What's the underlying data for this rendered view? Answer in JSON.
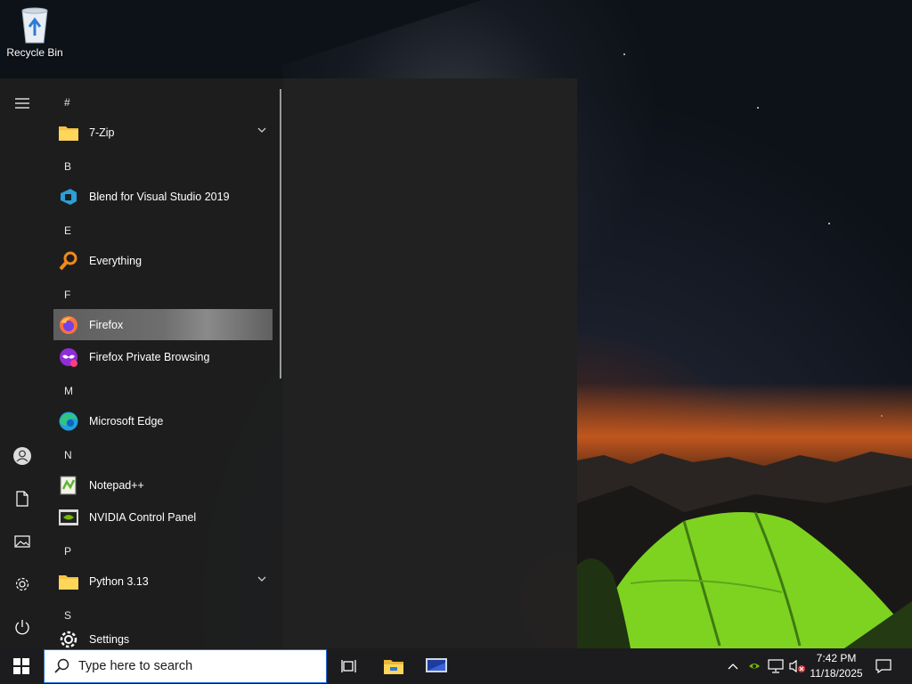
{
  "desktop": {
    "icons": [
      {
        "label": "Recycle Bin",
        "icon": "recycle-bin-icon"
      }
    ]
  },
  "start_menu": {
    "rail": [
      {
        "icon": "hamburger-menu-icon"
      },
      {
        "icon": "user-account-icon"
      },
      {
        "icon": "documents-icon"
      },
      {
        "icon": "pictures-icon"
      },
      {
        "icon": "settings-gear-icon"
      },
      {
        "icon": "power-icon"
      }
    ],
    "headers": {
      "hash": "#",
      "b": "B",
      "e": "E",
      "f": "F",
      "m": "M",
      "n": "N",
      "p": "P",
      "s": "S"
    },
    "apps": {
      "sevenzip": {
        "label": "7-Zip",
        "icon": "folder-icon",
        "expandable": true
      },
      "blend": {
        "label": "Blend for Visual Studio 2019",
        "icon": "blend-icon"
      },
      "everything": {
        "label": "Everything",
        "icon": "magnifier-search-icon"
      },
      "firefox": {
        "label": "Firefox",
        "icon": "firefox-icon",
        "state": "hover"
      },
      "firefox_private": {
        "label": "Firefox Private Browsing",
        "icon": "firefox-private-icon"
      },
      "edge": {
        "label": "Microsoft Edge",
        "icon": "edge-icon"
      },
      "notepadpp": {
        "label": "Notepad++",
        "icon": "notepadpp-icon"
      },
      "nvidia": {
        "label": "NVIDIA Control Panel",
        "icon": "nvidia-icon"
      },
      "python": {
        "label": "Python 3.13",
        "icon": "folder-icon",
        "expandable": true
      },
      "settings": {
        "label": "Settings",
        "icon": "settings-gear-icon"
      }
    }
  },
  "taskbar": {
    "search_placeholder": "Type here to search",
    "buttons": [
      "start-windows-icon",
      "task-view-icon",
      "file-explorer-icon",
      "remote-desktop-icon"
    ],
    "tray": [
      "show-hidden-icons-chevron",
      "nvidia-tray-icon",
      "network-icon",
      "volume-muted-icon",
      "notifications-icon"
    ],
    "time": "7:42 PM",
    "date": "11/18/2025"
  },
  "colors": {
    "accent": "#1f6fd6",
    "menu_bg": "#1e1e1e",
    "taskbar_bg": "#1c1c1e",
    "tent": "#8ee22a"
  }
}
